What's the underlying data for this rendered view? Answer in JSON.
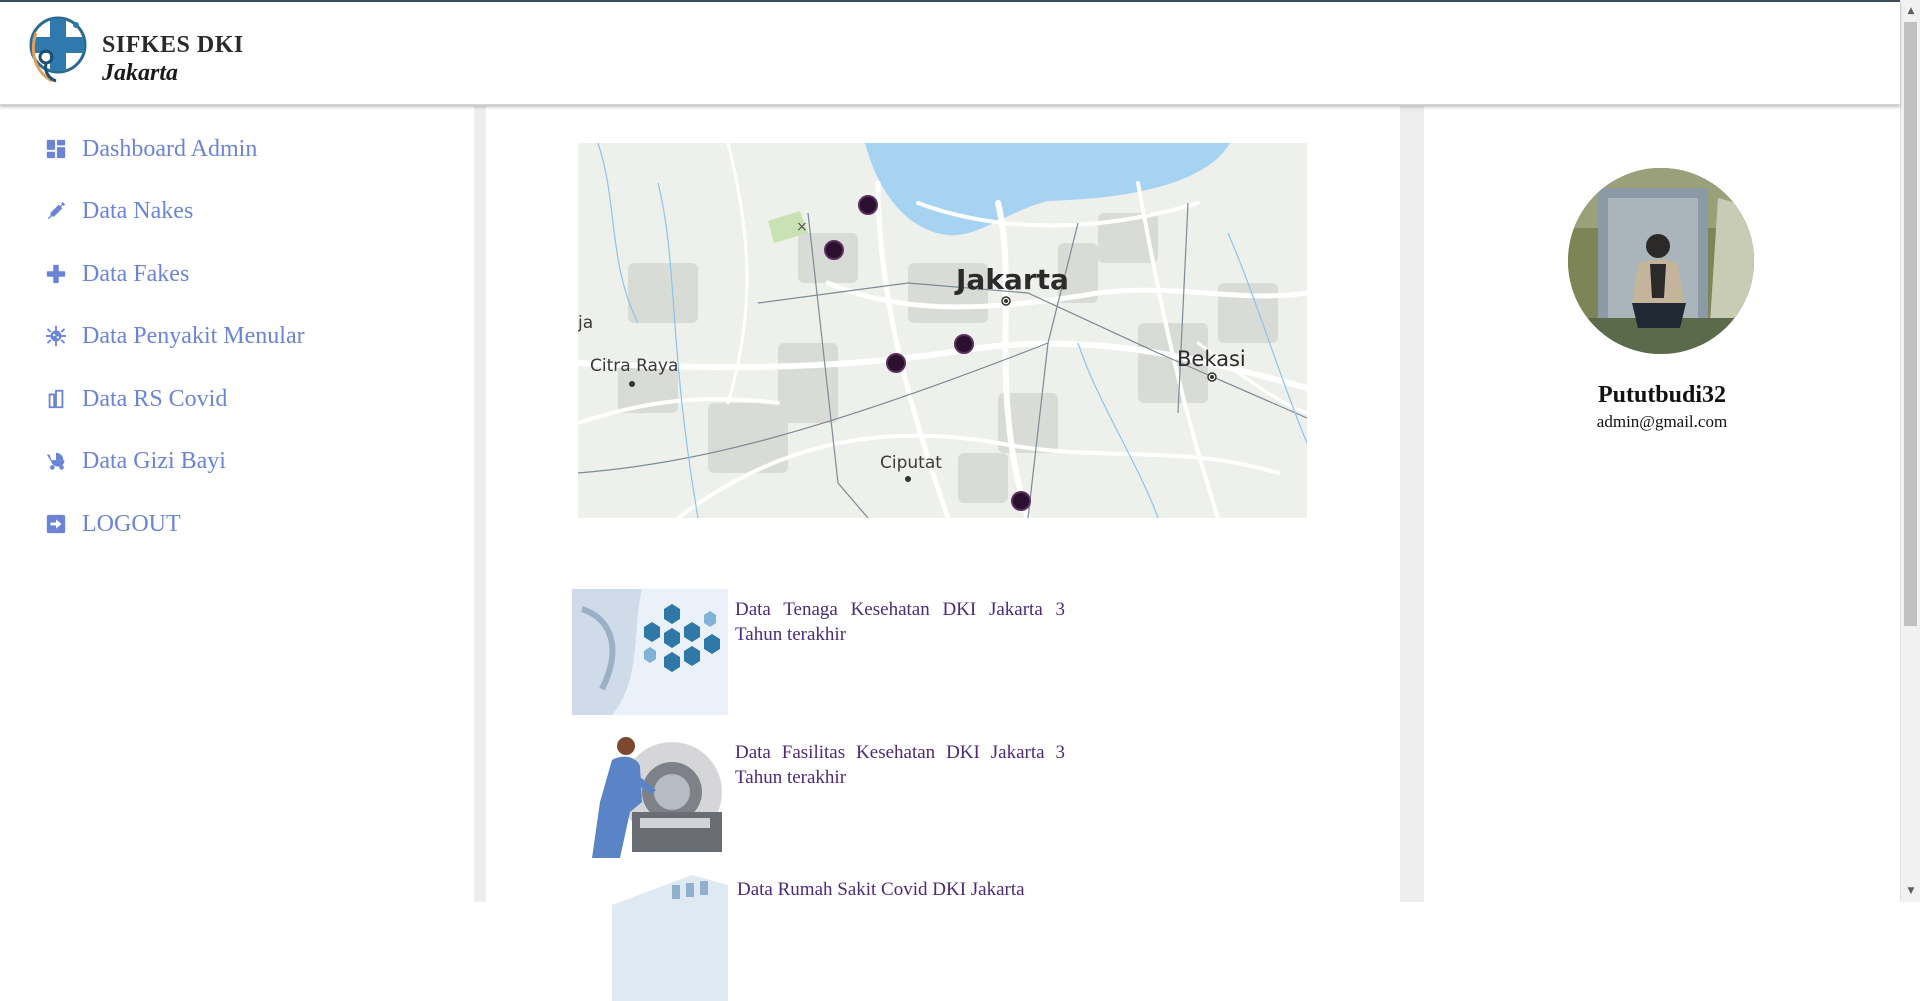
{
  "header": {
    "title": "SIFKES DKI",
    "subtitle": "Jakarta"
  },
  "sidebar": {
    "items": [
      {
        "label": "Dashboard Admin",
        "icon": "dashboard-icon"
      },
      {
        "label": "Data Nakes",
        "icon": "syringe-icon"
      },
      {
        "label": "Data Fakes",
        "icon": "plus-icon"
      },
      {
        "label": "Data Penyakit Menular",
        "icon": "virus-icon"
      },
      {
        "label": "Data RS Covid",
        "icon": "hospital-building-icon"
      },
      {
        "label": "Data Gizi Bayi",
        "icon": "baby-carriage-icon"
      },
      {
        "label": "LOGOUT",
        "icon": "logout-icon"
      }
    ]
  },
  "map": {
    "labels": {
      "jakarta": "Jakarta",
      "bekasi": "Bekasi",
      "citra_raya": "Citra Raya",
      "ciputat": "Ciputat",
      "edge": "ja"
    }
  },
  "cards": [
    {
      "title": "Data Tenaga Kesehatan DKI Jakarta 3 Tahun terakhir"
    },
    {
      "title": "Data Fasilitas Kesehatan DKI Jakarta 3 Tahun terakhir"
    },
    {
      "title": "Data Rumah Sakit Covid DKI Jakarta"
    }
  ],
  "profile": {
    "username": "Pututbudi32",
    "email": "admin@gmail.com"
  },
  "colors": {
    "nav": "#6c84d6",
    "card_title": "#4b2a7a",
    "water": "#a7d3f3",
    "marker": "#2a0f2e"
  }
}
